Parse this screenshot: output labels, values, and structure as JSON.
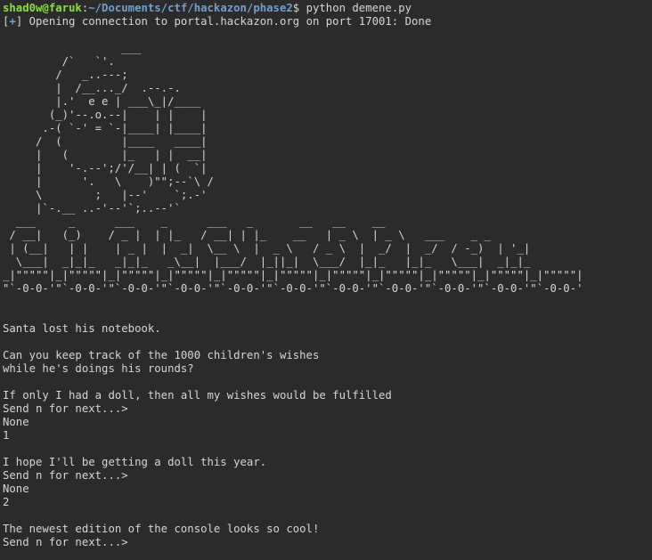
{
  "prompt": {
    "user_host": "shad0w@faruk",
    "colon": ":",
    "path": "~/Documents/ctf/hackazon/phase2",
    "symbol": "$",
    "command": " python demene.py"
  },
  "status": {
    "bracket_open": "[",
    "plus": "+",
    "bracket_close": "]",
    "text": " Opening connection to portal.hackazon.org on port 17001: Done"
  },
  "santa_art": [
    "",
    "                  ___",
    "         /`   `'.  ",
    "        /   _..---;",
    "        |  /__..._/  .--.-.",
    "        |.'  e e | ___\\_|/____",
    "       (_)'--.o.--|    | |    |",
    "      .-( `-' = `-|____| |____|",
    "     /  (         |____   ____|",
    "     |   (        |_   | |  __|",
    "     |    '-.--';/'/__| | (  `|",
    "     |      '.   \\    )\"\";--`\\ /",
    "     \\        ;   |--'    `;.-'",
    "     |`-.__ ..-'--'`;..--'`"
  ],
  "banner_art": [
    "  ___     _      ___    _      ___   _       __   __    __",
    " / __|   (_)    / _ |  | |_   / __| | |_    __   | _ \\  | _ \\   ___    _ _",
    " | (__|   | |    | _ |  |  _|  \\__ \\  |  _ \\   / _ \\  |  _/  |  _/  / -_)  | '_|",
    "  \\___|  _|_|_   _|_|_   _\\__|  |___/  |_||_|  \\___/  |_|_   |_|_   \\___|  _|_|_",
    "_|\"\"\"\"\"|_|\"\"\"\"\"|_|\"\"\"\"\"|_|\"\"\"\"\"|_|\"\"\"\"\"|_|\"\"\"\"\"|_|\"\"\"\"\"|_|\"\"\"\"\"|_|\"\"\"\"\"|_|\"\"\"\"\"|_|\"\"\"\"\"|",
    "\"`-0-0-'\"`-0-0-'\"`-0-0-'\"`-0-0-'\"`-0-0-'\"`-0-0-'\"`-0-0-'\"`-0-0-'\"`-0-0-'\"`-0-0-'\"`-0-0-'"
  ],
  "output_lines": [
    "",
    "",
    "Santa lost his notebook.",
    "",
    "Can you keep track of the 1000 children's wishes",
    "while he's doings his rounds?",
    "",
    "If only I had a doll, then all my wishes would be fulfilled",
    "Send n for next...>",
    "None",
    "1",
    "",
    "I hope I'll be getting a doll this year.",
    "Send n for next...>",
    "None",
    "2",
    "",
    "The newest edition of the console looks so cool!",
    "Send n for next...>"
  ]
}
